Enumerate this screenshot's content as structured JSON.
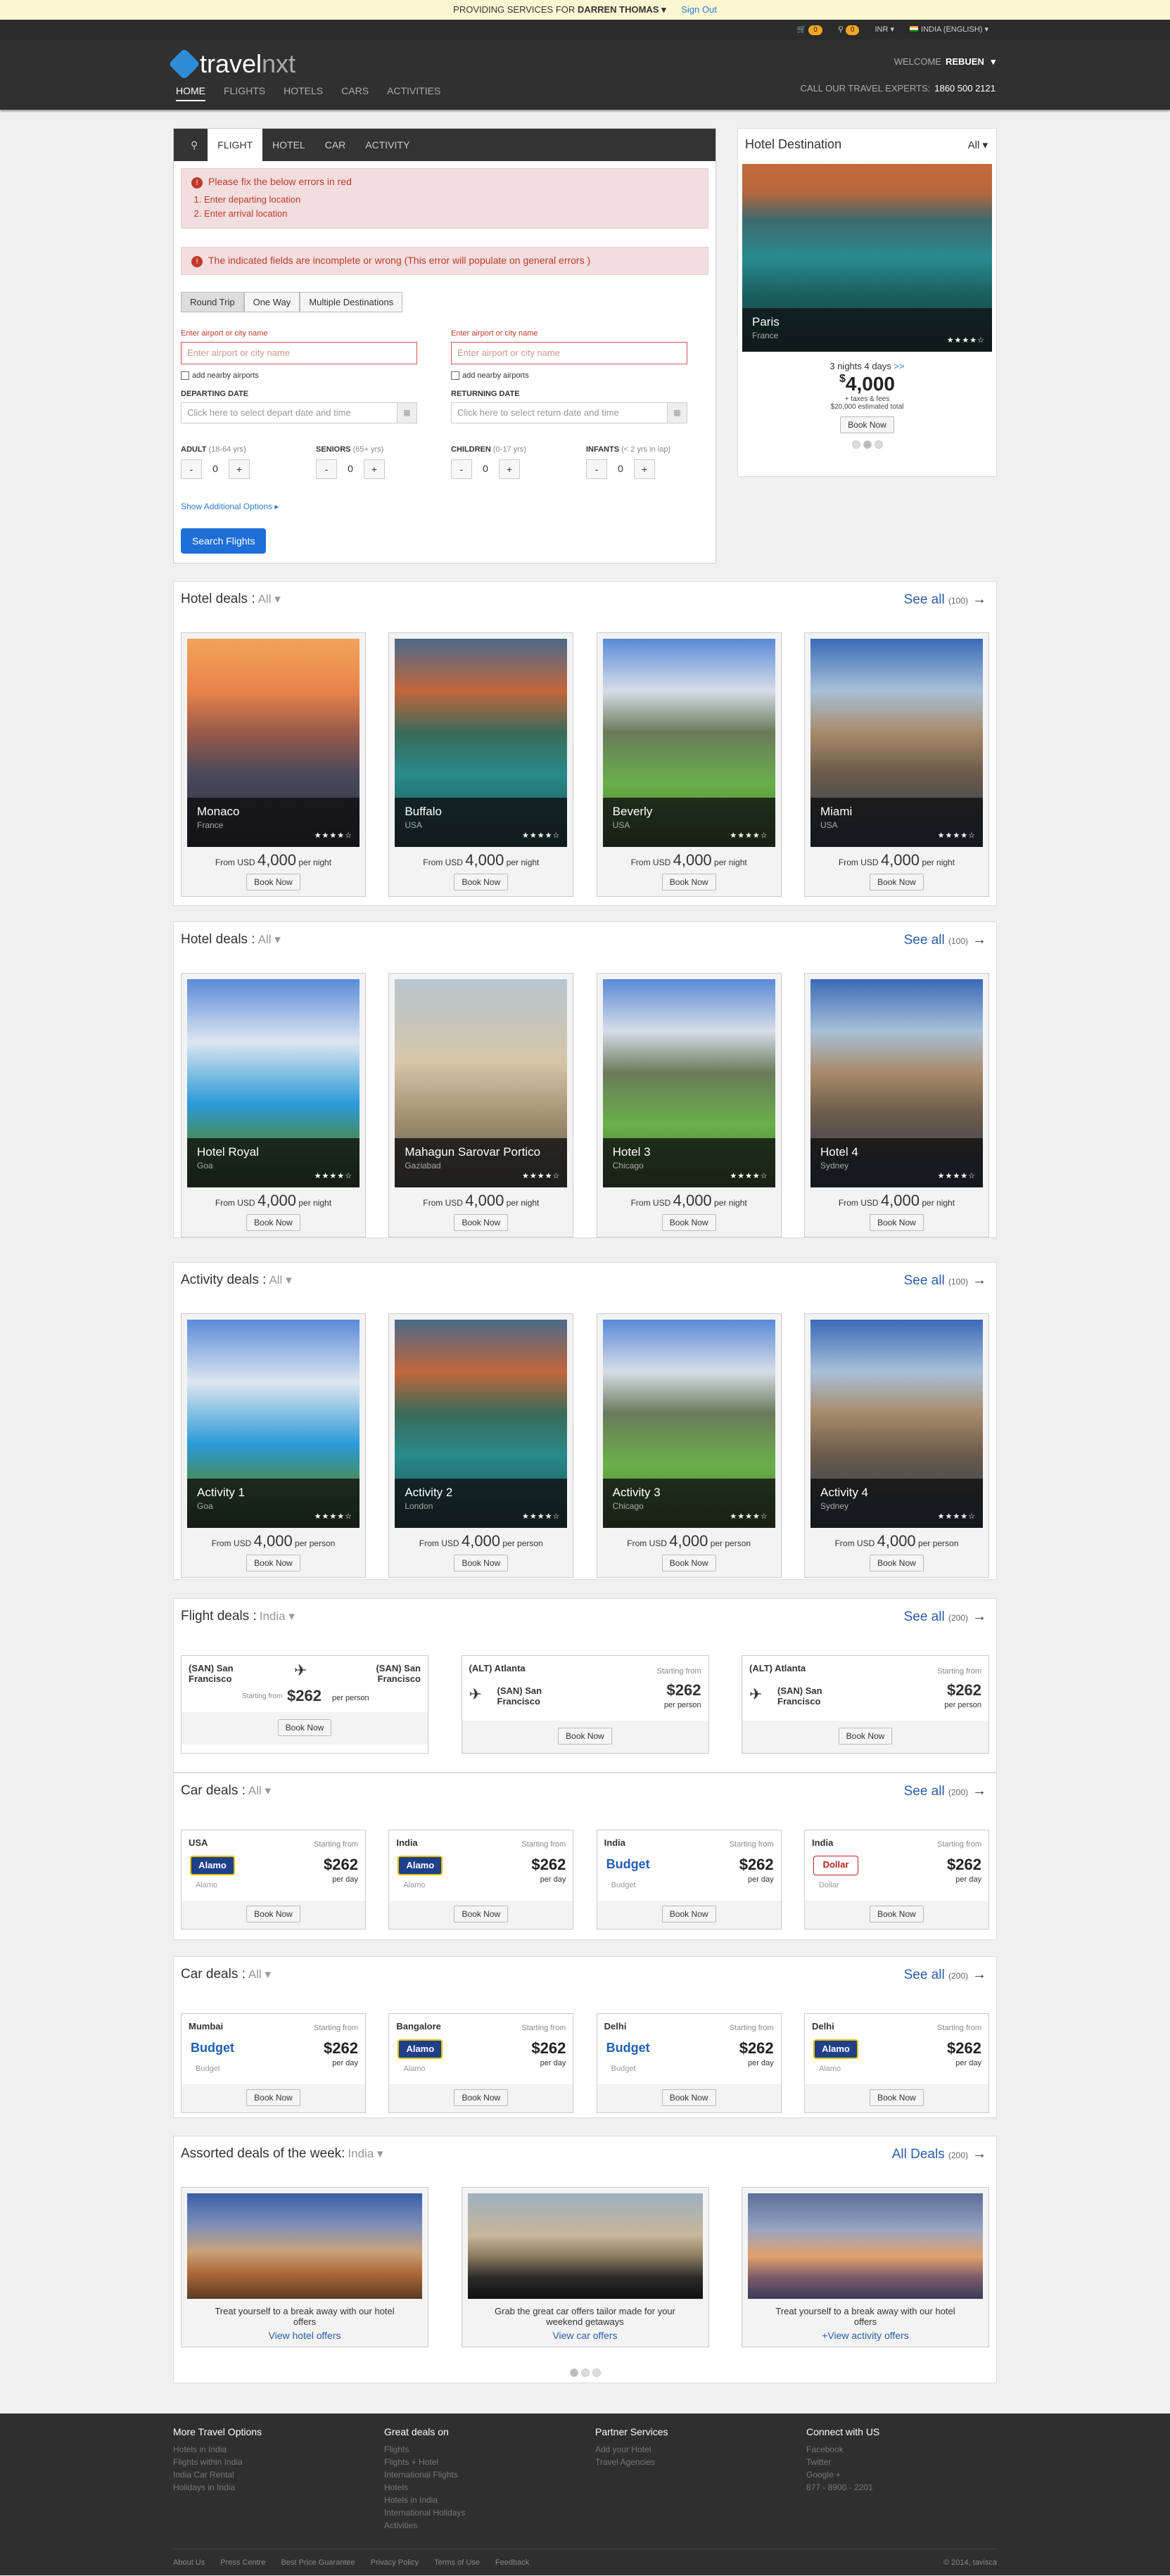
{
  "topbar": {
    "text": "PROVIDING SERVICES FOR",
    "user": "DARREN THOMAS",
    "signout": "Sign Out"
  },
  "utilbar": {
    "cart_count": "0",
    "search_count": "0",
    "currency": "INR",
    "language": "INDIA (ENGLISH)"
  },
  "header": {
    "logo_text": "travel",
    "logo_text2": "nxt",
    "nav": [
      "HOME",
      "FLIGHTS",
      "HOTELS",
      "CARS",
      "ACTIVITIES"
    ],
    "welcome": "WELCOME",
    "username": "REBUEN",
    "call_label": "CALL OUR TRAVEL EXPERTS:",
    "call_number": "1860 500 2121"
  },
  "search": {
    "tabs": [
      "FLIGHT",
      "HOTEL",
      "CAR",
      "ACTIVITY"
    ],
    "error_title": "Please fix the below errors in red",
    "errors": [
      "Enter departing location",
      "Enter arrival location"
    ],
    "error2": "The indicated fields are incomplete or wrong (This error will populate on general errors )",
    "trip_types": [
      "Round Trip",
      "One Way",
      "Multiple Destinations"
    ],
    "from_label": "Enter airport or city name",
    "from_placeholder": "Enter airport or city name",
    "to_label": "Enter airport or city name",
    "to_placeholder": "Enter airport or city name",
    "nearby": "add nearby airports",
    "depart_label": "DEPARTING DATE",
    "depart_placeholder": "Click here to select depart date and time",
    "return_label": "RETURNING DATE",
    "return_placeholder": "Click here to select return date and time",
    "adult": "ADULT",
    "adult_note": "(18-64 yrs)",
    "seniors": "SENIORS",
    "seniors_note": "(65+ yrs)",
    "children": "CHILDREN",
    "children_note": "(0-17 yrs)",
    "infants": "INFANTS",
    "infants_note": "(< 2 yrs in lap)",
    "count": "0",
    "additional": "Show Additional Options",
    "search_btn": "Search Flights"
  },
  "hotel_dest": {
    "title": "Hotel Destination",
    "filter": "All",
    "city": "Paris",
    "country": "France",
    "nights": "3 nights 4 days",
    "nights_link": ">>",
    "price": "4,000",
    "currency": "$",
    "taxes": "+ taxes & fees",
    "estimate": "$20,000 estimated total",
    "book": "Book Now"
  },
  "sections": [
    {
      "title": "Hotel deals :",
      "filter": "All",
      "seeall": "See all",
      "count": "(100)",
      "unit": "per night",
      "items": [
        {
          "name": "Monaco",
          "place": "France",
          "price": "4,000"
        },
        {
          "name": "Buffalo",
          "place": "USA",
          "price": "4,000"
        },
        {
          "name": "Beverly",
          "place": "USA",
          "price": "4,000"
        },
        {
          "name": "Miami",
          "place": "USA",
          "price": "4,000"
        }
      ]
    },
    {
      "title": "Hotel deals :",
      "filter": "All",
      "seeall": "See all",
      "count": "(100)",
      "unit": "per night",
      "items": [
        {
          "name": "Hotel Royal",
          "place": "Goa",
          "price": "4,000"
        },
        {
          "name": "Mahagun Sarovar Portico",
          "place": "Gaziabad",
          "price": "4,000"
        },
        {
          "name": "Hotel 3",
          "place": "Chicago",
          "price": "4,000"
        },
        {
          "name": "Hotel 4",
          "place": "Sydney",
          "price": "4,000"
        }
      ]
    },
    {
      "title": "Activity deals :",
      "filter": "All",
      "seeall": "See all",
      "count": "(100)",
      "unit": "per person",
      "items": [
        {
          "name": "Activity 1",
          "place": "Goa",
          "price": "4,000"
        },
        {
          "name": "Activity 2",
          "place": "London",
          "price": "4,000"
        },
        {
          "name": "Activity 3",
          "place": "Chicago",
          "price": "4,000"
        },
        {
          "name": "Activity 4",
          "place": "Sydney",
          "price": "4,000"
        }
      ]
    }
  ],
  "common": {
    "from": "From",
    "usd": "USD",
    "book": "Book Now",
    "stars": "★★★★☆"
  },
  "flights": {
    "title": "Flight deals :",
    "filter": "India",
    "seeall": "See all",
    "count": "(200)",
    "starting": "Starting from",
    "price": "$262",
    "per": "per person",
    "items": [
      {
        "from": "(SAN) San Francisco",
        "to": "(SAN) San Francisco"
      },
      {
        "from": "(ALT) Atlanta",
        "to": "(SAN) San Francisco"
      },
      {
        "from": "(ALT) Atlanta",
        "to": "(SAN) San Francisco"
      }
    ]
  },
  "cars1": {
    "title": "Car deals :",
    "filter": "All",
    "seeall": "See all",
    "count": "(200)",
    "starting": "Starting from",
    "price": "$262",
    "per": "per day",
    "items": [
      {
        "loc": "USA",
        "brand": "Alamo",
        "logo": "alamo"
      },
      {
        "loc": "India",
        "brand": "Alamo",
        "logo": "alamo"
      },
      {
        "loc": "India",
        "brand": "Budget",
        "logo": "budget"
      },
      {
        "loc": "India",
        "brand": "Dollar",
        "logo": "dollar"
      }
    ]
  },
  "cars2": {
    "title": "Car deals :",
    "filter": "All",
    "seeall": "See all",
    "count": "(200)",
    "starting": "Starting from",
    "price": "$262",
    "per": "per day",
    "items": [
      {
        "loc": "Mumbai",
        "brand": "Budget",
        "logo": "budget"
      },
      {
        "loc": "Bangalore",
        "brand": "Alamo",
        "logo": "alamo"
      },
      {
        "loc": "Delhi",
        "brand": "Budget",
        "logo": "budget"
      },
      {
        "loc": "Delhi",
        "brand": "Alamo",
        "logo": "alamo"
      }
    ]
  },
  "assorted": {
    "title": "Assorted deals of the week:",
    "filter": "India",
    "seeall": "All Deals",
    "count": "(200)",
    "items": [
      {
        "text": "Treat yourself to a break away with our hotel offers",
        "link": "View hotel offers"
      },
      {
        "text": "Grab the great car offers tailor made for your weekend getaways",
        "link": "View car offers"
      },
      {
        "text": "Treat yourself to a break away with our hotel offers",
        "link": "+View activity offers"
      }
    ]
  },
  "footer": {
    "cols": [
      {
        "title": "More Travel Options",
        "items": [
          "Hotels in India",
          "Flights within India",
          "India Car Rental",
          "Holidays in India"
        ]
      },
      {
        "title": "Great deals on",
        "items": [
          "Flights",
          "Flights + Hotel",
          "International Flights",
          "Hotels",
          "Hotels in India",
          "International Holidays",
          "Activities"
        ]
      },
      {
        "title": "Partner Services",
        "items": [
          "Add your Hotel",
          "Travel Agencies"
        ]
      },
      {
        "title": "Connect with US",
        "items": [
          "Facebook",
          "Twitter",
          "Google +",
          "877 - 8900 - 2201"
        ]
      }
    ],
    "links": [
      "About Us",
      "Press Centre",
      "Best Price Guarantee",
      "Privacy Policy",
      "Terms of Use",
      "Feedback"
    ],
    "copyright": "© 2014, tavisca"
  }
}
